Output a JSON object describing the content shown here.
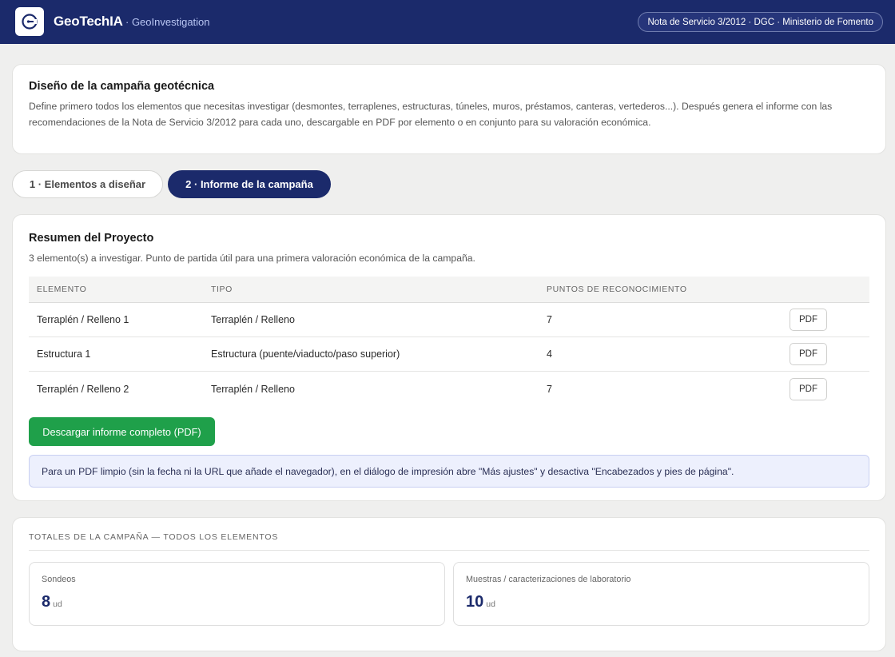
{
  "header": {
    "brand": "GeoTechIA",
    "subtitle": "· GeoInvestigation",
    "normative": "Nota de Servicio 3/2012 · DGC · Ministerio de Fomento"
  },
  "intro": {
    "title": "Diseño de la campaña geotécnica",
    "text": "Define primero todos los elementos que necesitas investigar (desmontes, terraplenes, estructuras, túneles, muros, préstamos, canteras, vertederos...). Después genera el informe con las recomendaciones de la Nota de Servicio 3/2012 para cada uno, descargable en PDF por elemento o en conjunto para su valoración económica."
  },
  "tabs": [
    {
      "label": "1 · Elementos a diseñar",
      "active": false
    },
    {
      "label": "2 · Informe de la campaña",
      "active": true
    }
  ],
  "summary": {
    "title": "Resumen del Proyecto",
    "subtitle": "3 elemento(s) a investigar. Punto de partida útil para una primera valoración económica de la campaña.",
    "columns": [
      "ELEMENTO",
      "TIPO",
      "PUNTOS DE RECONOCIMIENTO"
    ],
    "rows": [
      {
        "elemento": "Terraplén / Relleno 1",
        "tipo": "Terraplén / Relleno",
        "puntos": "7",
        "action": "PDF"
      },
      {
        "elemento": "Estructura 1",
        "tipo": "Estructura (puente/viaducto/paso superior)",
        "puntos": "4",
        "action": "PDF"
      },
      {
        "elemento": "Terraplén / Relleno 2",
        "tipo": "Terraplén / Relleno",
        "puntos": "7",
        "action": "PDF"
      }
    ],
    "download_label": "Descargar informe completo (PDF)",
    "notice": "Para un PDF limpio (sin la fecha ni la URL que añade el navegador), en el diálogo de impresión abre \"Más ajustes\" y desactiva \"Encabezados y pies de página\"."
  },
  "totals": {
    "label": "TOTALES DE LA CAMPAÑA — TODOS LOS ELEMENTOS",
    "stats": [
      {
        "label": "Sondeos",
        "value": "8",
        "unit": "ud"
      },
      {
        "label": "Muestras / caracterizaciones de laboratorio",
        "value": "10",
        "unit": "ud"
      }
    ]
  },
  "colors": {
    "primary": "#1b2a6b",
    "success": "#1fa04a",
    "notice_bg": "#edf0fd"
  }
}
